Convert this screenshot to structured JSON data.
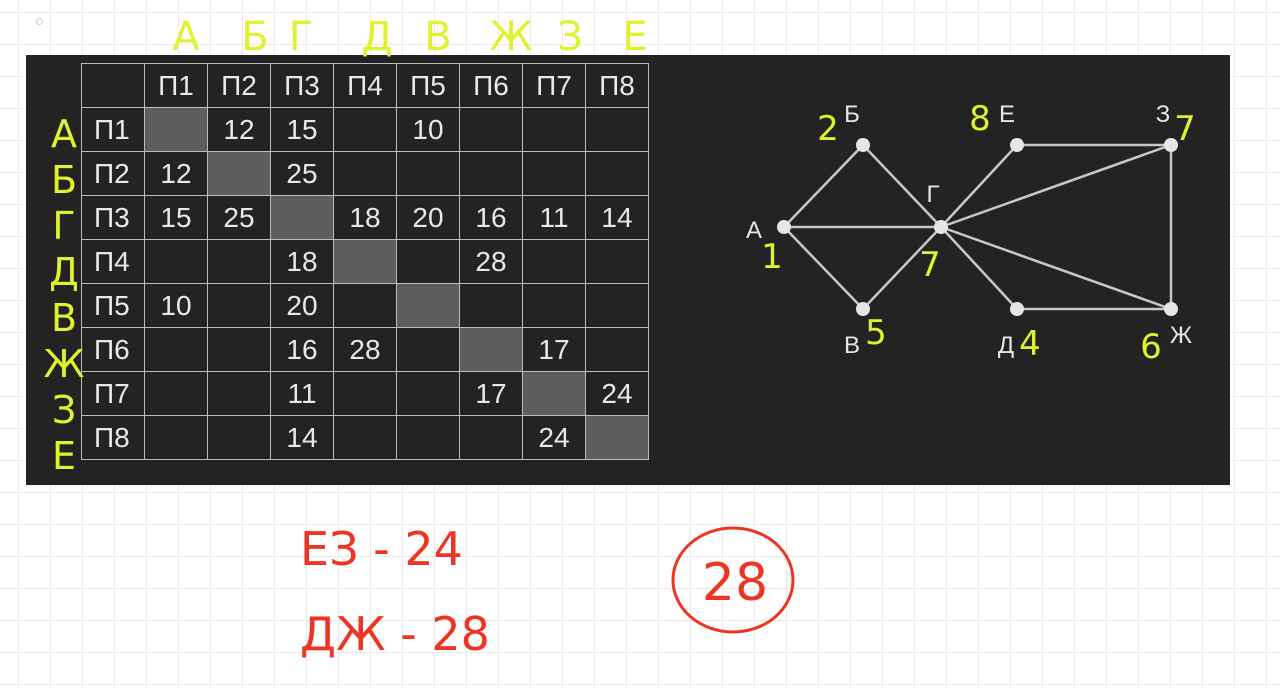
{
  "table": {
    "col_headers": [
      "П1",
      "П2",
      "П3",
      "П4",
      "П5",
      "П6",
      "П7",
      "П8"
    ],
    "rows": [
      {
        "label": "П1",
        "cells": [
          "",
          "12",
          "15",
          "",
          "10",
          "",
          "",
          ""
        ]
      },
      {
        "label": "П2",
        "cells": [
          "12",
          "",
          "25",
          "",
          "",
          "",
          "",
          ""
        ]
      },
      {
        "label": "П3",
        "cells": [
          "15",
          "25",
          "",
          "18",
          "20",
          "16",
          "11",
          "14"
        ]
      },
      {
        "label": "П4",
        "cells": [
          "",
          "",
          "18",
          "",
          "",
          "28",
          "",
          ""
        ]
      },
      {
        "label": "П5",
        "cells": [
          "10",
          "",
          "20",
          "",
          "",
          "",
          "",
          ""
        ]
      },
      {
        "label": "П6",
        "cells": [
          "",
          "",
          "16",
          "28",
          "",
          "",
          "17",
          ""
        ]
      },
      {
        "label": "П7",
        "cells": [
          "",
          "",
          "11",
          "",
          "",
          "17",
          "",
          "24"
        ]
      },
      {
        "label": "П8",
        "cells": [
          "",
          "",
          "14",
          "",
          "",
          "",
          "24",
          ""
        ]
      }
    ]
  },
  "graph": {
    "vertices": [
      {
        "id": "A",
        "label": "А",
        "number": "1"
      },
      {
        "id": "B",
        "label": "Б",
        "number": "2"
      },
      {
        "id": "G",
        "label": "Г",
        "number": "7"
      },
      {
        "id": "V",
        "label": "В",
        "number": "5"
      },
      {
        "id": "E",
        "label": "Е",
        "number": "8"
      },
      {
        "id": "D",
        "label": "Д",
        "number": "4"
      },
      {
        "id": "Z",
        "label": "З",
        "number": "7"
      },
      {
        "id": "ZH",
        "label": "Ж",
        "number": "6"
      }
    ],
    "edges": [
      [
        "A",
        "B"
      ],
      [
        "A",
        "G"
      ],
      [
        "A",
        "V"
      ],
      [
        "B",
        "G"
      ],
      [
        "V",
        "G"
      ],
      [
        "G",
        "E"
      ],
      [
        "G",
        "Z"
      ],
      [
        "G",
        "D"
      ],
      [
        "G",
        "ZH"
      ],
      [
        "E",
        "Z"
      ],
      [
        "Z",
        "ZH"
      ],
      [
        "D",
        "ZH"
      ]
    ]
  },
  "annotations": {
    "column_letters": [
      "А",
      "Б",
      "Г",
      "Д",
      "В",
      "Ж",
      "З",
      "Е"
    ],
    "row_letters": [
      "А",
      "Б",
      "Г",
      "Д",
      "В",
      "Ж",
      "З",
      "Е"
    ],
    "notes": [
      "ЕЗ - 24",
      "ДЖ - 28"
    ],
    "answer": "28"
  },
  "colors": {
    "panel": "#232323",
    "table_line": "#bdbdbd",
    "diagonal_cell": "#5e5e5e",
    "ink_yellow": "#dff230",
    "ink_red": "#ee3524"
  }
}
